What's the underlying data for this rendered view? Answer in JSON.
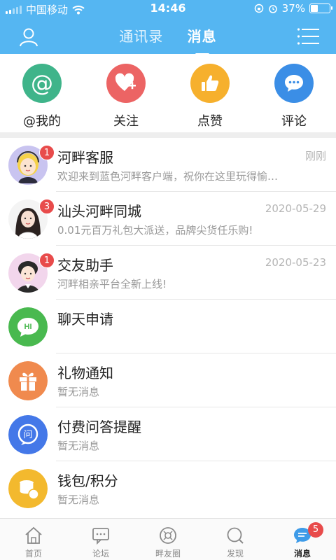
{
  "status_bar": {
    "carrier": "中国移动",
    "time": "14:46",
    "battery": "37%",
    "battery_level": 0.37
  },
  "header": {
    "tabs": [
      {
        "label": "通讯录",
        "active": false
      },
      {
        "label": "消息",
        "active": true
      }
    ],
    "user_icon": "user-icon",
    "menu_icon": "menu-icon",
    "bg_color": "#55b6f2"
  },
  "quick_actions": [
    {
      "label": "@我的",
      "icon": "at-icon",
      "color": "#3fb48a"
    },
    {
      "label": "关注",
      "icon": "heart-plus-icon",
      "color": "#ec6464"
    },
    {
      "label": "点赞",
      "icon": "thumbs-up-icon",
      "color": "#f6b02d"
    },
    {
      "label": "评论",
      "icon": "comment-icon",
      "color": "#3b8ee6"
    }
  ],
  "messages": [
    {
      "title": "河畔客服",
      "time": "刚刚",
      "preview": "欢迎来到蓝色河畔客户端，祝你在这里玩得愉…",
      "badge": "1"
    },
    {
      "title": "汕头河畔同城",
      "time": "2020-05-29",
      "preview": "0.01元百万礼包大派送，品牌尖货任乐购!",
      "badge": "3"
    },
    {
      "title": "交友助手",
      "time": "2020-05-23",
      "preview": "河畔相亲平台全新上线!",
      "badge": "1"
    },
    {
      "title": "聊天申请",
      "time": "",
      "preview": "",
      "badge": "",
      "icon_text": "HI"
    },
    {
      "title": "礼物通知",
      "time": "",
      "preview": "暂无消息",
      "badge": ""
    },
    {
      "title": "付费问答提醒",
      "time": "",
      "preview": "暂无消息",
      "badge": "",
      "icon_text": "问"
    },
    {
      "title": "钱包/积分",
      "time": "",
      "preview": "暂无消息",
      "badge": ""
    }
  ],
  "bottom_nav": [
    {
      "label": "首页",
      "icon": "home-icon",
      "active": false
    },
    {
      "label": "论坛",
      "icon": "forum-icon",
      "active": false
    },
    {
      "label": "畔友圈",
      "icon": "circle-icon",
      "active": false
    },
    {
      "label": "发现",
      "icon": "discover-icon",
      "active": false
    },
    {
      "label": "消息",
      "icon": "message-icon",
      "active": true,
      "badge": "5"
    }
  ]
}
